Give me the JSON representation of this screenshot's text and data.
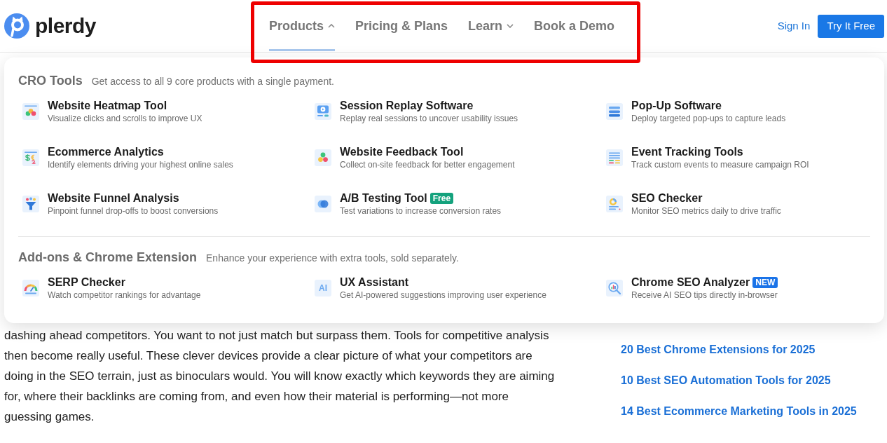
{
  "header": {
    "logo": "plerdy",
    "nav": [
      {
        "label": "Products",
        "kind": "dropdown",
        "expanded": true,
        "selected": true
      },
      {
        "label": "Pricing & Plans",
        "kind": "link",
        "selected": false
      },
      {
        "label": "Learn",
        "kind": "dropdown",
        "expanded": false,
        "selected": false
      },
      {
        "label": "Book a Demo",
        "kind": "link",
        "selected": false
      }
    ],
    "nav_highlighted": true,
    "sign_in": "Sign In",
    "cta": "Try It Free"
  },
  "products_menu": {
    "sections": [
      {
        "title": "CRO Tools",
        "subtitle": "Get access to all 9 core products with a single payment.",
        "items": [
          {
            "title": "Website Heatmap Tool",
            "description": "Visualize clicks and scrolls to improve UX"
          },
          {
            "title": "Session Replay Software",
            "description": "Replay real sessions to uncover usability issues"
          },
          {
            "title": "Pop-Up Software",
            "description": "Deploy targeted pop-ups to capture leads"
          },
          {
            "title": "Ecommerce Analytics",
            "description": "Identify elements driving your highest online sales"
          },
          {
            "title": "Website Feedback Tool",
            "description": "Collect on-site feedback for better engagement"
          },
          {
            "title": "Event Tracking Tools",
            "description": "Track custom events to measure campaign ROI"
          },
          {
            "title": "Website Funnel Analysis",
            "description": "Pinpoint funnel drop-offs to boost conversions"
          },
          {
            "title": "A/B Testing Tool",
            "description": "Test variations to increase conversion rates",
            "badge": {
              "label": "Free",
              "color": "#14a27d"
            }
          },
          {
            "title": "SEO Checker",
            "description": "Monitor SEO metrics daily to drive traffic"
          }
        ]
      },
      {
        "title": "Add-ons & Chrome Extension",
        "subtitle": "Enhance your experience with extra tools, sold separately.",
        "items": [
          {
            "title": "SERP Checker",
            "description": "Watch competitor rankings for advantage"
          },
          {
            "title": "UX Assistant",
            "description": "Get AI-powered suggestions improving user experience",
            "icon_text": "AI"
          },
          {
            "title": "Chrome SEO Analyzer",
            "description": "Receive AI SEO tips directly in-browser",
            "badge": {
              "label": "NEW",
              "color": "#1a73e8"
            }
          }
        ]
      }
    ]
  },
  "article": {
    "lines": [
      "dashing ahead competitors. You want to not just match but surpass them. Tools for competitive analysis",
      "then become really useful. These clever devices provide a clear picture of what your competitors are",
      "doing in the SEO terrain, just as binoculars would. You will know exactly which keywords they are aiming",
      "for, where their backlinks are coming from, and even how their material is performing—not more",
      "guessing games."
    ]
  },
  "sidebar": {
    "links": [
      "20 Best Chrome Extensions for 2025",
      "10 Best SEO Automation Tools for 2025",
      "14 Best Ecommerce Marketing Tools in 2025"
    ]
  }
}
